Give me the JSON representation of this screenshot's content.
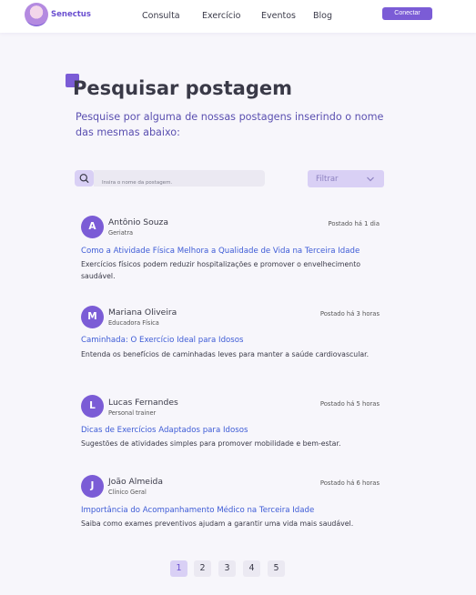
{
  "brand": {
    "name": "Senectus"
  },
  "nav": {
    "links": [
      "Consulta",
      "Exercício",
      "Eventos",
      "Blog"
    ],
    "connect_label": "Conectar"
  },
  "page": {
    "title": "Pesquisar postagem",
    "subtitle": "Pesquise por alguma de nossas postagens inserindo o nome das mesmas abaixo:"
  },
  "search": {
    "placeholder": "Insira o nome da postagem.",
    "filter_label": "Filtrar"
  },
  "posts": [
    {
      "initial": "A",
      "author": "Antônio Souza",
      "role": "Geriatra",
      "posted": "Postado há 1 dia",
      "title": "Como a Atividade Física Melhora a Qualidade de Vida na Terceira Idade",
      "excerpt": "Exercícios físicos podem reduzir hospitalizações e promover o envelhecimento saudável."
    },
    {
      "initial": "M",
      "author": "Mariana Oliveira",
      "role": "Educadora Física",
      "posted": "Postado há 3 horas",
      "title": "Caminhada: O Exercício Ideal para Idosos",
      "excerpt": "Entenda os benefícios de caminhadas leves para manter a saúde cardiovascular."
    },
    {
      "initial": "L",
      "author": "Lucas Fernandes",
      "role": "Personal trainer",
      "posted": "Postado há 5 horas",
      "title": "Dicas de Exercícios Adaptados para Idosos",
      "excerpt": "Sugestões de atividades simples para promover mobilidade e bem-estar."
    },
    {
      "initial": "J",
      "author": "João Almeida",
      "role": "Clínico Geral",
      "posted": "Postado há 6 horas",
      "title": "Importância do Acompanhamento Médico na Terceira Idade",
      "excerpt": "Saiba como exames preventivos ajudam a garantir uma vida mais saudável."
    }
  ],
  "pagination": {
    "pages": [
      "1",
      "2",
      "3",
      "4",
      "5"
    ],
    "current": "1"
  },
  "colors": {
    "accent": "#7b5cd6",
    "link": "#3d5bd6",
    "accent_light": "#d9d0f5"
  }
}
